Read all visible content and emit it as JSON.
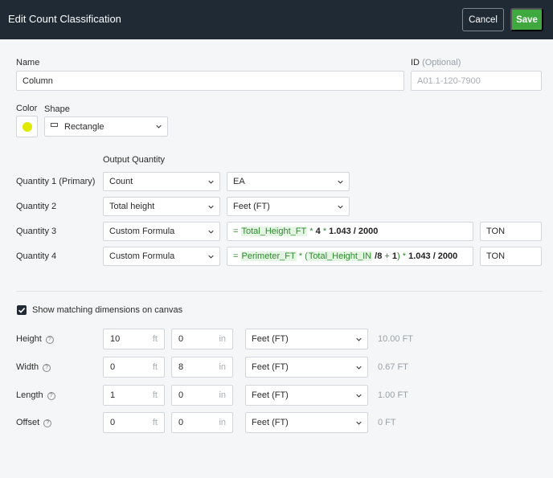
{
  "header": {
    "title": "Edit Count Classification",
    "cancel_label": "Cancel",
    "save_label": "Save"
  },
  "name": {
    "label": "Name",
    "value": "Column"
  },
  "id_field": {
    "label": "ID",
    "optional": "(Optional)",
    "placeholder": "A01.1-120-7900"
  },
  "color": {
    "label": "Color",
    "value": "#e0ea00"
  },
  "shape": {
    "label": "Shape",
    "value": "Rectangle",
    "icon": "rectangle-icon"
  },
  "output_quantity": {
    "header": "Output Quantity",
    "rows": [
      {
        "label": "Quantity 1 (Primary)",
        "type": "Count",
        "unit": "EA"
      },
      {
        "label": "Quantity 2",
        "type": "Total height",
        "unit": "Feet (FT)"
      },
      {
        "label": "Quantity 3",
        "type": "Custom Formula",
        "formula": {
          "eq": "=",
          "var1": "Total_Height_FT",
          "op1": "*",
          "num1": "4",
          "op2": "*",
          "num2": "1.043 / 2000"
        },
        "unit": "TON"
      },
      {
        "label": "Quantity 4",
        "type": "Custom Formula",
        "formula": {
          "eq": "=",
          "var1": "Perimeter_FT",
          "op1": "* (",
          "var2": "Total_Height_IN",
          "num1": "/8",
          "op2": "+",
          "num2": "1",
          "op3": ")",
          "op4": "*",
          "num3": "1.043 / 2000"
        },
        "unit": "TON"
      }
    ]
  },
  "show_dimensions": {
    "label": "Show matching dimensions on canvas",
    "checked": true
  },
  "dimensions": [
    {
      "label": "Height",
      "ft": "10",
      "ft_unit": "ft",
      "in": "0",
      "in_unit": "in",
      "unit": "Feet (FT)",
      "result": "10.00 FT"
    },
    {
      "label": "Width",
      "ft": "0",
      "ft_unit": "ft",
      "in": "8",
      "in_unit": "in",
      "unit": "Feet (FT)",
      "result": "0.67 FT"
    },
    {
      "label": "Length",
      "ft": "1",
      "ft_unit": "ft",
      "in": "0",
      "in_unit": "in",
      "unit": "Feet (FT)",
      "result": "1.00 FT"
    },
    {
      "label": "Offset",
      "ft": "0",
      "ft_unit": "ft",
      "in": "0",
      "in_unit": "in",
      "unit": "Feet (FT)",
      "result": "0 FT"
    }
  ],
  "help_glyph": "?"
}
